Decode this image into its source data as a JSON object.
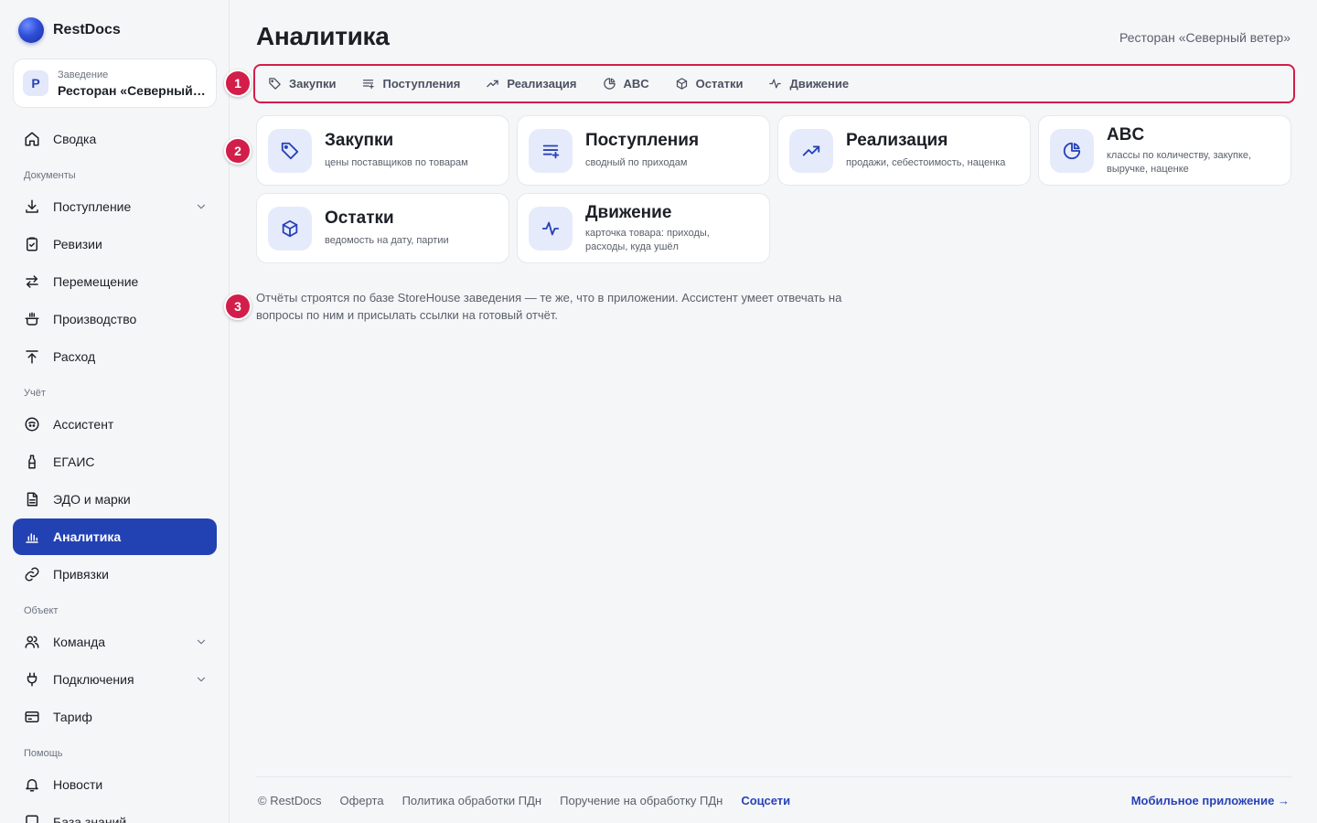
{
  "brand": {
    "name": "RestDocs"
  },
  "venue": {
    "caption": "Заведение",
    "name": "Ресторан «Северный ветер»",
    "avatar_letter": "Р"
  },
  "sidebar": {
    "top": [
      {
        "label": "Сводка",
        "icon": "home-icon"
      }
    ],
    "sections": [
      {
        "title": "Документы"
      },
      {
        "title": "Учёт"
      },
      {
        "title": "Объект"
      },
      {
        "title": "Помощь"
      }
    ],
    "documents": [
      {
        "label": "Поступление",
        "icon": "download-icon",
        "expandable": true
      },
      {
        "label": "Ревизии",
        "icon": "clipboard-check-icon"
      },
      {
        "label": "Перемещение",
        "icon": "transfer-arrows-icon"
      },
      {
        "label": "Производство",
        "icon": "cooking-pot-icon"
      },
      {
        "label": "Расход",
        "icon": "upload-icon"
      }
    ],
    "accounting": [
      {
        "label": "Ассистент",
        "icon": "assistant-icon"
      },
      {
        "label": "ЕГАИС",
        "icon": "bottle-icon"
      },
      {
        "label": "ЭДО и марки",
        "icon": "document-icon"
      },
      {
        "label": "Аналитика",
        "icon": "bar-chart-icon",
        "active": true
      },
      {
        "label": "Привязки",
        "icon": "link-icon"
      }
    ],
    "object": [
      {
        "label": "Команда",
        "icon": "users-icon",
        "expandable": true
      },
      {
        "label": "Подключения",
        "icon": "plug-icon",
        "expandable": true
      },
      {
        "label": "Тариф",
        "icon": "credit-card-icon"
      }
    ],
    "help": [
      {
        "label": "Новости",
        "icon": "bell-icon"
      },
      {
        "label": "База знаний",
        "icon": "book-icon"
      }
    ]
  },
  "header": {
    "title": "Аналитика",
    "venue": "Ресторан «Северный ветер»"
  },
  "tabs": [
    {
      "label": "Закупки",
      "icon": "tag-icon"
    },
    {
      "label": "Поступления",
      "icon": "list-plus-icon"
    },
    {
      "label": "Реализация",
      "icon": "trending-up-icon"
    },
    {
      "label": "ABC",
      "icon": "pie-chart-icon"
    },
    {
      "label": "Остатки",
      "icon": "box-icon"
    },
    {
      "label": "Движение",
      "icon": "activity-icon"
    }
  ],
  "cards": [
    {
      "title": "Закупки",
      "subtitle": "цены поставщиков по товарам",
      "icon": "tag-icon"
    },
    {
      "title": "Поступления",
      "subtitle": "сводный по приходам",
      "icon": "list-plus-icon"
    },
    {
      "title": "Реализация",
      "subtitle": "продажи, себестоимость, наценка",
      "icon": "trending-up-icon"
    },
    {
      "title": "ABC",
      "subtitle": "классы по количеству, закупке, выручке, наценке",
      "icon": "pie-chart-icon"
    },
    {
      "title": "Остатки",
      "subtitle": "ведомость на дату, партии",
      "icon": "box-icon"
    },
    {
      "title": "Движение",
      "subtitle": "карточка товара: приходы, расходы, куда ушёл",
      "icon": "activity-icon"
    }
  ],
  "note": "Отчёты строятся по базе StoreHouse заведения — те же, что в приложении. Ассистент умеет отвечать на вопросы по ним и присылать ссылки на готовый отчёт.",
  "markers": [
    "1",
    "2",
    "3"
  ],
  "footer": {
    "copyright": "© RestDocs",
    "links": [
      "Оферта",
      "Политика обработки ПДн",
      "Поручение на обработку ПДн"
    ],
    "accent_link": "Соцсети",
    "mobile_app": "Мобильное приложение →"
  },
  "colors": {
    "accent": "#2241b3",
    "marker": "#d21e4a",
    "background": "#f5f6f8"
  }
}
